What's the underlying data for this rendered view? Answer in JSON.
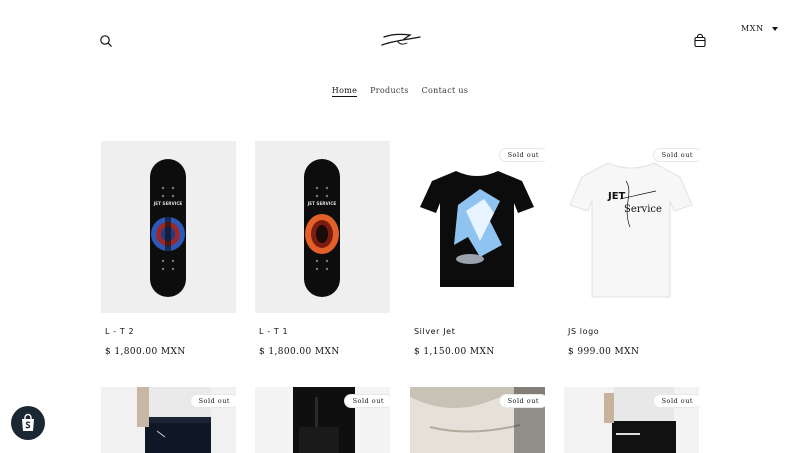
{
  "header": {
    "currency": "MXN",
    "icons": {
      "search": "search-icon",
      "logo": "brand-logo",
      "cart": "cart-icon",
      "currency_caret": "caret-down-icon"
    }
  },
  "nav": {
    "items": [
      {
        "label": "Home",
        "active": true
      },
      {
        "label": "Products",
        "active": false
      },
      {
        "label": "Contact us",
        "active": false
      }
    ]
  },
  "products": [
    {
      "title": "L - T 2",
      "price": "$ 1,800.00 MXN",
      "sold_out": false
    },
    {
      "title": "L - T 1",
      "price": "$ 1,800.00 MXN",
      "sold_out": false
    },
    {
      "title": "Silver Jet",
      "price": "$ 1,150.00 MXN",
      "sold_out": true
    },
    {
      "title": "JS logo",
      "price": "$ 999.00 MXN",
      "sold_out": true
    }
  ],
  "products_row2": [
    {
      "sold_out": true
    },
    {
      "sold_out": true
    },
    {
      "sold_out": true
    },
    {
      "sold_out": true
    }
  ],
  "labels": {
    "sold_out": "Sold out",
    "deck_text": "JET SERVICE",
    "shirt_text_1": "JET",
    "shirt_text_2": "Service"
  },
  "colors": {
    "text": "#121212",
    "card_bg": "#efefef",
    "badge_border": "#e8e8e8",
    "shop_badge_bg": "#1b2733"
  }
}
